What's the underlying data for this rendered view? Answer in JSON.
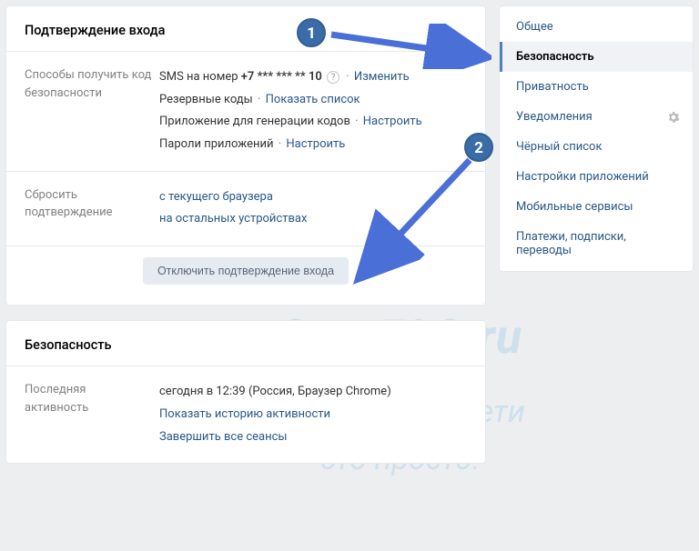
{
  "confirmation_panel": {
    "title": "Подтверждение входа",
    "methods_label": "Способы получить код безопасности",
    "sms_prefix": "SMS на номер ",
    "sms_number": "+7 *** *** ** 10",
    "sms_change": "Изменить",
    "backup_codes": "Резервные коды",
    "backup_show": "Показать список",
    "auth_app": "Приложение для генерации кодов",
    "auth_app_configure": "Настроить",
    "app_passwords": "Пароли приложений",
    "app_passwords_configure": "Настроить",
    "reset_label": "Сбросить подтверждение",
    "reset_current": "с текущего браузера",
    "reset_others": "на остальных устройствах",
    "disable_btn": "Отключить подтверждение входа"
  },
  "security_panel": {
    "title": "Безопасность",
    "last_activity_label": "Последняя активность",
    "last_activity_value": "сегодня в 12:39 (Россия, Браузер Chrome)",
    "show_history": "Показать историю активности",
    "end_all": "Завершить все сеансы"
  },
  "sidebar": {
    "items": [
      {
        "label": "Общее",
        "active": false
      },
      {
        "label": "Безопасность",
        "active": true
      },
      {
        "label": "Приватность",
        "active": false
      },
      {
        "label": "Уведомления",
        "active": false,
        "gear": true
      },
      {
        "label": "Чёрный список",
        "active": false
      },
      {
        "label": "Настройки приложений",
        "active": false
      },
      {
        "label": "Мобильные сервисы",
        "active": false
      },
      {
        "label": "Платежи, подписки, переводы",
        "active": false
      }
    ]
  },
  "annotations": {
    "badge1": "1",
    "badge2": "2"
  },
  "watermark": {
    "line1": "Soc-FAQ.ru",
    "line2": "Социальные сети",
    "line3": "это просто!"
  }
}
